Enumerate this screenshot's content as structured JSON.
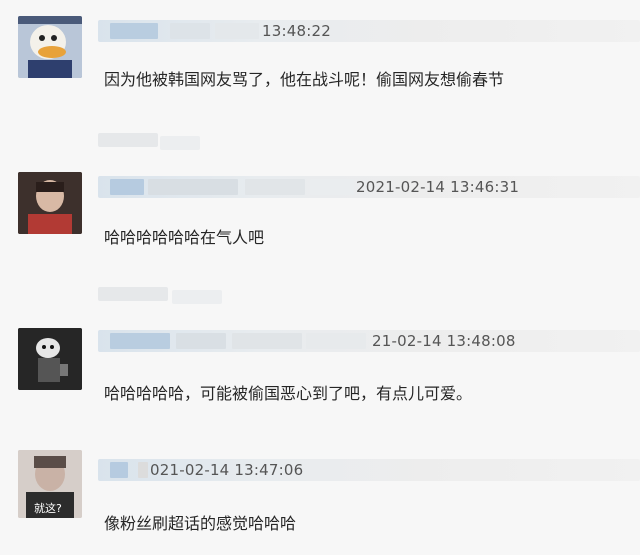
{
  "comments": [
    {
      "timestamp": "13:48:22",
      "text": "因为他被韩国网友骂了，他在战斗呢！偷国网友想偷春节"
    },
    {
      "timestamp": "2021-02-14 13:46:31",
      "text": "哈哈哈哈哈哈在气人吧"
    },
    {
      "timestamp": "21-02-14 13:48:08",
      "text": "哈哈哈哈哈，可能被偷国恶心到了吧，有点儿可爱。"
    },
    {
      "timestamp": "021-02-14 13:47:06",
      "text": "像粉丝刷超话的感觉哈哈哈",
      "avatar_label": "就这?"
    }
  ],
  "icons": {
    "avatar1": "donald-duck-avatar-icon",
    "avatar2": "person-avatar-icon",
    "avatar3": "figure-avatar-icon",
    "avatar4": "person-avatar-icon"
  }
}
